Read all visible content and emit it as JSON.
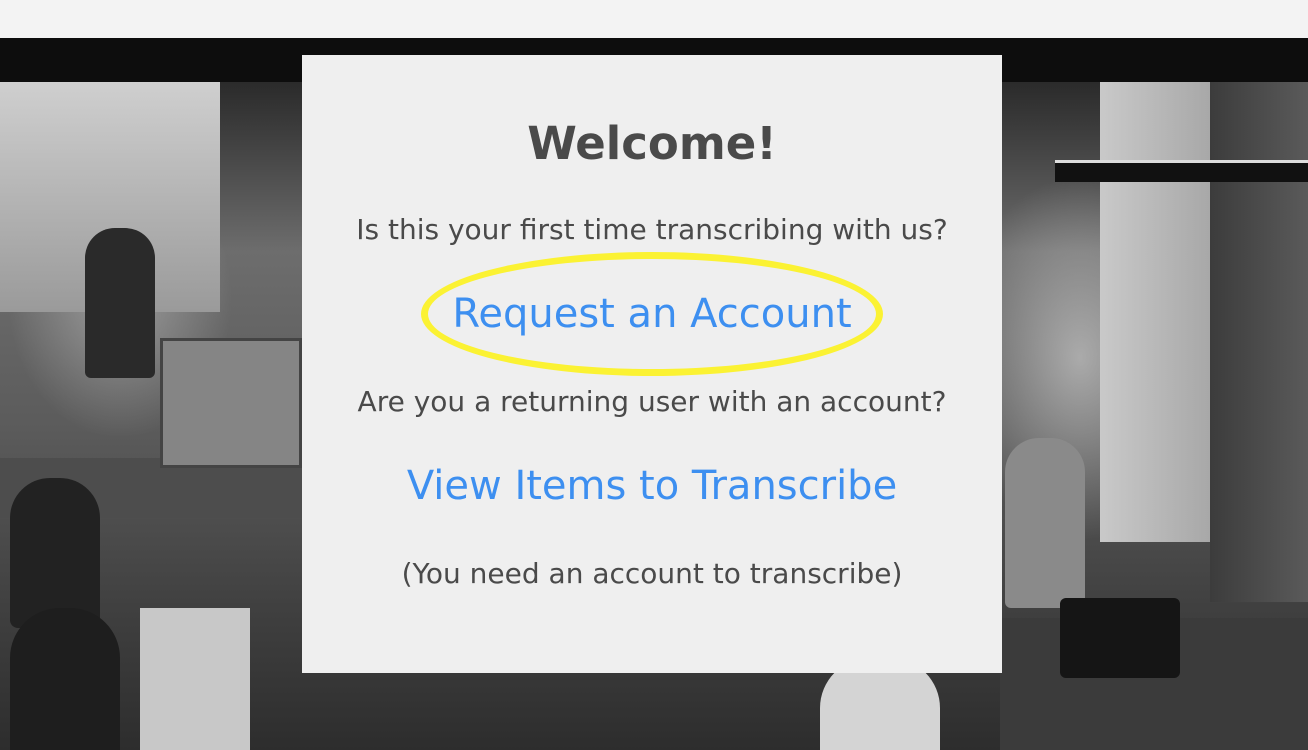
{
  "welcome_card": {
    "title": "Welcome!",
    "first_time_question": "Is this your first time transcribing with us?",
    "request_account_link": "Request an Account",
    "returning_question": "Are you a returning user with an account?",
    "view_items_link": "View Items to Transcribe",
    "account_note": "(You need an account to transcribe)"
  },
  "colors": {
    "link": "#3d8ff0",
    "highlight": "#fbf233",
    "card_background": "#efefef",
    "text": "#4a4a4a"
  }
}
